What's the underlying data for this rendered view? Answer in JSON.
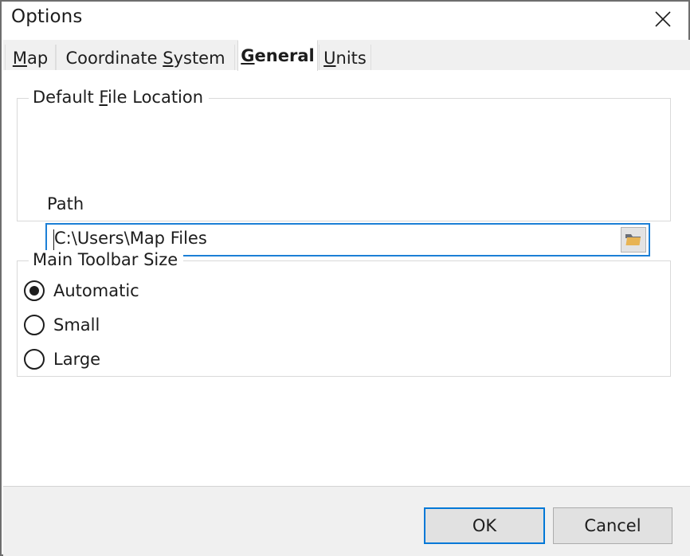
{
  "window": {
    "title": "Options",
    "close_icon": "close-icon"
  },
  "tabs": [
    {
      "label": "Map",
      "mnemonic": "M",
      "active": false
    },
    {
      "label": "Coordinate System",
      "mnemonic": "S",
      "active": false
    },
    {
      "label": "General",
      "mnemonic": "G",
      "active": true
    },
    {
      "label": "Units",
      "mnemonic": "U",
      "active": false
    }
  ],
  "groups": {
    "default_file_location": {
      "title": "Default File Location",
      "mnemonic": "F",
      "path_label": "Path",
      "path_value": "C:\\Users\\Map Files",
      "browse_icon": "folder-icon"
    },
    "main_toolbar_size": {
      "title": "Main Toolbar Size",
      "options": [
        {
          "label": "Automatic",
          "selected": true
        },
        {
          "label": "Small",
          "selected": false
        },
        {
          "label": "Large",
          "selected": false
        }
      ]
    }
  },
  "footer": {
    "ok_label": "OK",
    "cancel_label": "Cancel"
  },
  "colors": {
    "accent": "#0078d7",
    "field_focus": "#1c7fd6",
    "dialog_bg": "#ffffff",
    "footer_bg": "#f0f0f0",
    "tab_bg": "#f0f0f0",
    "folder_front": "#e8b454",
    "folder_back": "#6b6f76"
  }
}
